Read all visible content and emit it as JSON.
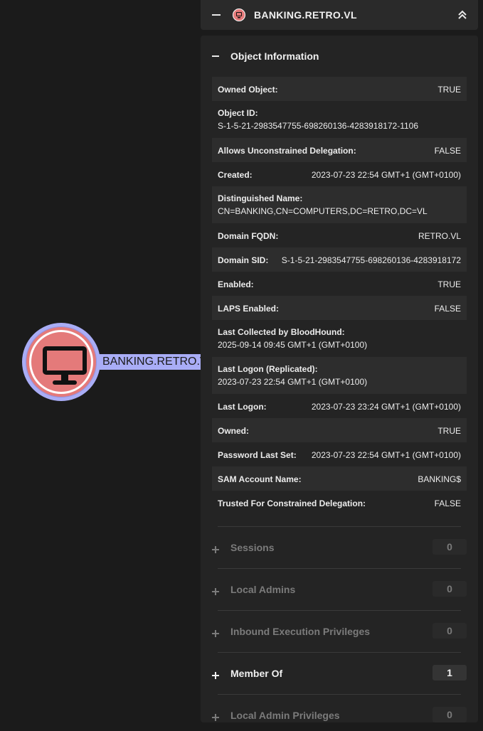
{
  "graph": {
    "node_label": "BANKING.RETRO.VL"
  },
  "panel": {
    "title": "BANKING.RETRO.VL",
    "section_title": "Object Information",
    "properties": [
      {
        "label": "Owned Object:",
        "value": "TRUE",
        "layout": "single"
      },
      {
        "label": "Object ID:",
        "value": "S-1-5-21-2983547755-698260136-4283918172-1106",
        "layout": "double"
      },
      {
        "label": "Allows Unconstrained Delegation:",
        "value": "FALSE",
        "layout": "single"
      },
      {
        "label": "Created:",
        "value": "2023-07-23 22:54 GMT+1 (GMT+0100)",
        "layout": "single"
      },
      {
        "label": "Distinguished Name:",
        "value": "CN=BANKING,CN=COMPUTERS,DC=RETRO,DC=VL",
        "layout": "double"
      },
      {
        "label": "Domain FQDN:",
        "value": "RETRO.VL",
        "layout": "single"
      },
      {
        "label": "Domain SID:",
        "value": "S-1-5-21-2983547755-698260136-4283918172",
        "layout": "single"
      },
      {
        "label": "Enabled:",
        "value": "TRUE",
        "layout": "single"
      },
      {
        "label": "LAPS Enabled:",
        "value": "FALSE",
        "layout": "single"
      },
      {
        "label": "Last Collected by BloodHound:",
        "value": "2025-09-14 09:45 GMT+1 (GMT+0100)",
        "layout": "double"
      },
      {
        "label": "Last Logon (Replicated):",
        "value": "2023-07-23 22:54 GMT+1 (GMT+0100)",
        "layout": "double"
      },
      {
        "label": "Last Logon:",
        "value": "2023-07-23 23:24 GMT+1 (GMT+0100)",
        "layout": "single"
      },
      {
        "label": "Owned:",
        "value": "TRUE",
        "layout": "single"
      },
      {
        "label": "Password Last Set:",
        "value": "2023-07-23 22:54 GMT+1 (GMT+0100)",
        "layout": "single"
      },
      {
        "label": "SAM Account Name:",
        "value": "BANKING$",
        "layout": "single"
      },
      {
        "label": "Trusted For Constrained Delegation:",
        "value": "FALSE",
        "layout": "single"
      }
    ],
    "accordions": [
      {
        "label": "Sessions",
        "count": "0",
        "active": false
      },
      {
        "label": "Local Admins",
        "count": "0",
        "active": false
      },
      {
        "label": "Inbound Execution Privileges",
        "count": "0",
        "active": false
      },
      {
        "label": "Member Of",
        "count": "1",
        "active": true
      },
      {
        "label": "Local Admin Privileges",
        "count": "0",
        "active": false
      }
    ]
  },
  "colors": {
    "node_fill": "#e47a7a",
    "node_ring": "#a9adf6",
    "panel_bg": "#242424",
    "row_alt": "#2d2d2d"
  },
  "icons": {
    "node": "computer-icon",
    "header": "computer-icon",
    "collapse": "chevron-double-up-icon"
  }
}
